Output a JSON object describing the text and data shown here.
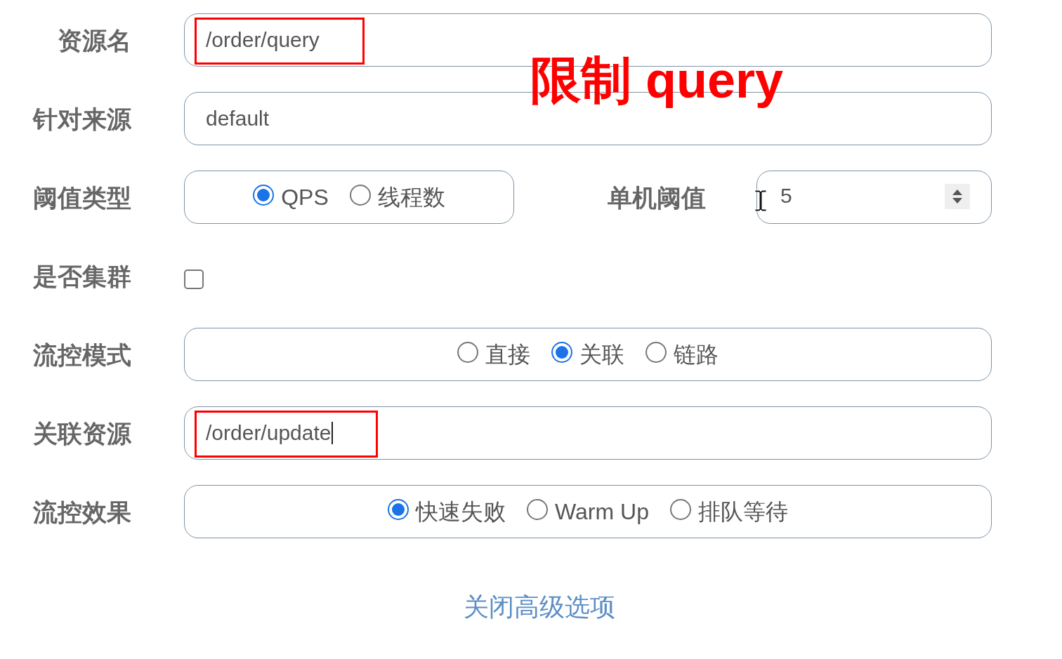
{
  "form": {
    "rows": [
      {
        "kind": "text",
        "label": "资源名",
        "value": "/order/query",
        "highlighted": true,
        "focused": false
      },
      {
        "kind": "text",
        "label": "针对来源",
        "value": "default",
        "highlighted": false,
        "focused": false
      },
      {
        "kind": "threshold",
        "label": "阈值类型",
        "options": [
          {
            "label": "QPS",
            "selected": true
          },
          {
            "label": "线程数",
            "selected": false
          }
        ],
        "single_threshold": {
          "label": "单机阈值",
          "value": "5"
        }
      },
      {
        "kind": "checkbox",
        "label": "是否集群",
        "checked": false
      },
      {
        "kind": "radio",
        "label": "流控模式",
        "options": [
          {
            "label": "直接",
            "selected": false
          },
          {
            "label": "关联",
            "selected": true
          },
          {
            "label": "链路",
            "selected": false
          }
        ]
      },
      {
        "kind": "text",
        "label": "关联资源",
        "value": "/order/update",
        "highlighted": true,
        "focused": true
      },
      {
        "kind": "radio",
        "label": "流控效果",
        "options": [
          {
            "label": "快速失败",
            "selected": true
          },
          {
            "label": "Warm Up",
            "selected": false
          },
          {
            "label": "排队等待",
            "selected": false
          }
        ]
      }
    ]
  },
  "toggle_link": "关闭高级选项",
  "annotation": {
    "text": "限制 query"
  }
}
